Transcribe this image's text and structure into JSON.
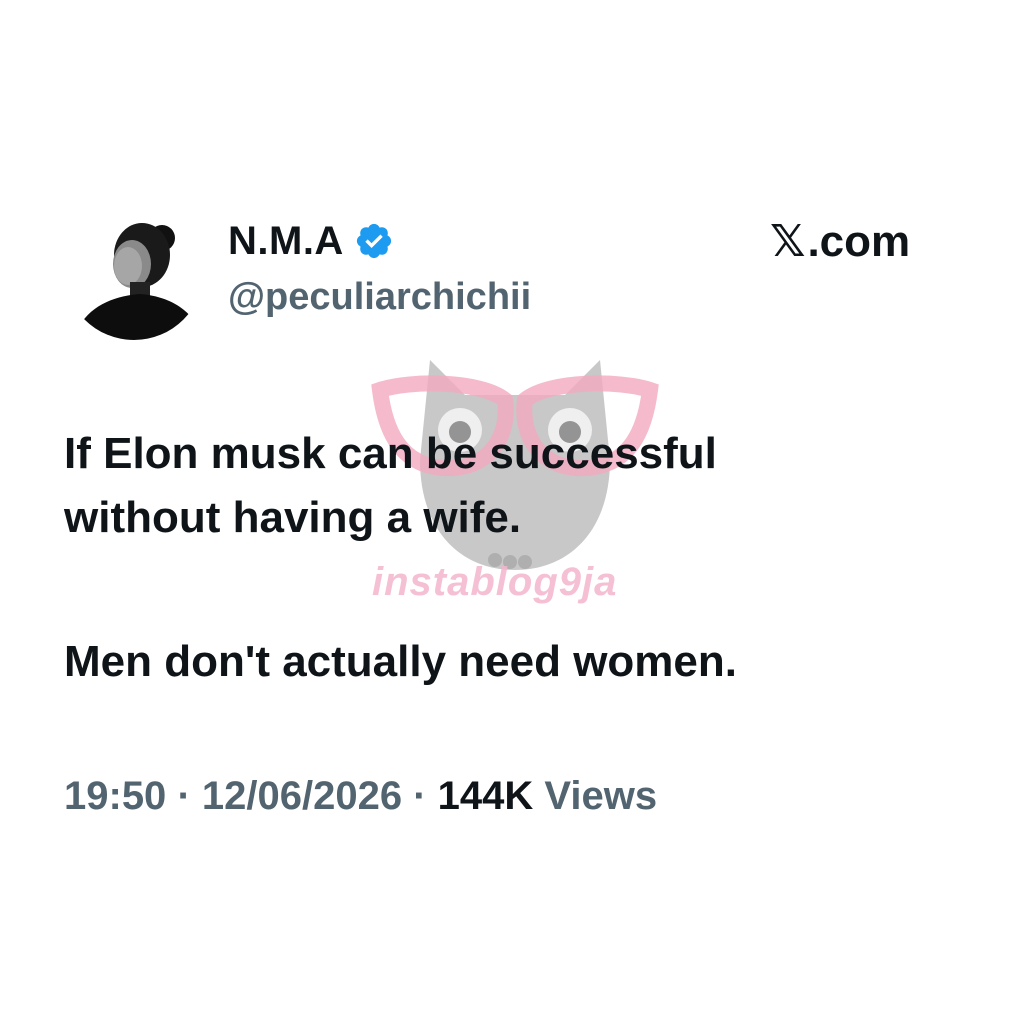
{
  "author": {
    "display_name": "N.M.A",
    "handle": "@peculiarchichii",
    "verified": true,
    "badge_color": "#1d9bf0",
    "avatar_icon": "profile-photo"
  },
  "site": {
    "logo_mark": "𝕏",
    "logo_text": ".com"
  },
  "tweet": {
    "lines": [
      "If Elon musk can be successful",
      "without having a wife.",
      "Men don't actually need women."
    ]
  },
  "meta": {
    "time": "19:50",
    "separator": "·",
    "date": "12/06/2026",
    "views_count": "144K",
    "views_label": "Views"
  },
  "watermark": {
    "text": "instablog9ja",
    "icon": "owl-with-glasses-icon",
    "color": "#f4b4cd"
  },
  "colors": {
    "text_primary": "#0f1419",
    "text_secondary": "#536471",
    "background": "#ffffff"
  }
}
